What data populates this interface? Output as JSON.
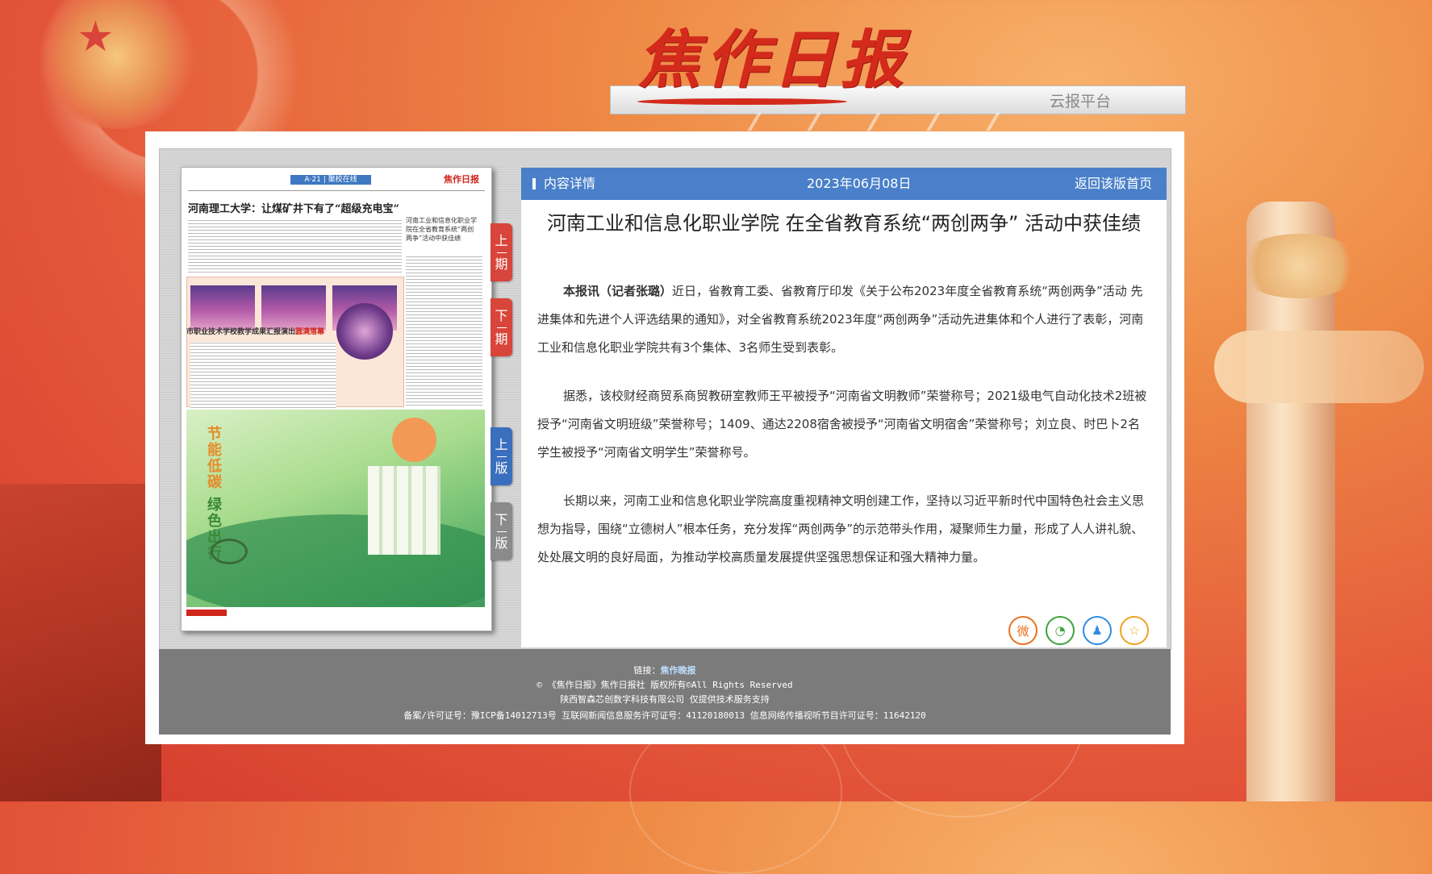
{
  "header": {
    "logo_text": "焦作日报",
    "subtitle": "云报平台"
  },
  "newspaper": {
    "edition_label": "A·21 | 聚校在线",
    "masthead": "焦作日报",
    "headline": "河南理工大学：让煤矿井下有了“超级充电宝”",
    "side_headline": "河南工业和信息化职业学院在全省教育系统“两创两争”活动中获佳绩",
    "caption_main": "市职业技术学校教学成果汇报演出",
    "caption_highlight": "圆满落幕",
    "ad_title_a": "节能低碳",
    "ad_title_b": "绿色出行"
  },
  "tabs": {
    "prev_issue": [
      "上",
      "期"
    ],
    "next_issue": [
      "下",
      "期"
    ],
    "prev_page": [
      "上",
      "版"
    ],
    "next_page": [
      "下",
      "版"
    ]
  },
  "article_bar": {
    "label": "内容详情",
    "date": "2023年06月08日",
    "back": "返回该版首页"
  },
  "article": {
    "title": "河南工业和信息化职业学院 在全省教育系统“两创两争” 活动中获佳绩",
    "lead_bold": "本报讯（记者张璐）",
    "para1": "近日，省教育工委、省教育厅印发《关于公布2023年度全省教育系统“两创两争”活动 先进集体和先进个人评选结果的通知》，对全省教育系统2023年度“两创两争”活动先进集体和个人进行了表彰，河南工业和信息化职业学院共有3个集体、3名师生受到表彰。",
    "para2": "据悉，该校财经商贸系商贸教研室教师王平被授予“河南省文明教师”荣誉称号；2021级电气自动化技术2班被授予“河南省文明班级”荣誉称号；1409、通达2208宿舍被授予“河南省文明宿舍”荣誉称号；刘立良、时巴卜2名学生被授予“河南省文明学生”荣誉称号。",
    "para3": "长期以来，河南工业和信息化职业学院高度重视精神文明创建工作，坚持以习近平新时代中国特色社会主义思想为指导，围绕“立德树人”根本任务，充分发挥“两创两争”的示范带头作用，凝聚师生力量，形成了人人讲礼貌、处处展文明的良好局面，为推动学校高质量发展提供坚强思想保证和强大精神力量。"
  },
  "share": {
    "icons": [
      "weibo-icon",
      "wechat-icon",
      "qq-icon",
      "favorite-icon"
    ],
    "colors": [
      "#e8711f",
      "#3aa43a",
      "#2d8de0",
      "#f0a020"
    ]
  },
  "footer": {
    "link_label": "链接：",
    "link_text": "焦作晚报",
    "copyright": "©  《焦作日报》焦作日报社    版权所有©All Rights Reserved",
    "tech": "陕西智森芯创数字科技有限公司 仅提供技术服务支持",
    "license": "备案/许可证号：豫ICP备14012713号 互联网新闻信息服务许可证号：41120180013 信息网络传播视听节目许可证号：11642120"
  },
  "colors": {
    "accent_blue": "#4a80c9",
    "tab_red": "#d8453a",
    "tab_blue": "#3a6fbd",
    "footer_gray": "#7b7b7b"
  }
}
